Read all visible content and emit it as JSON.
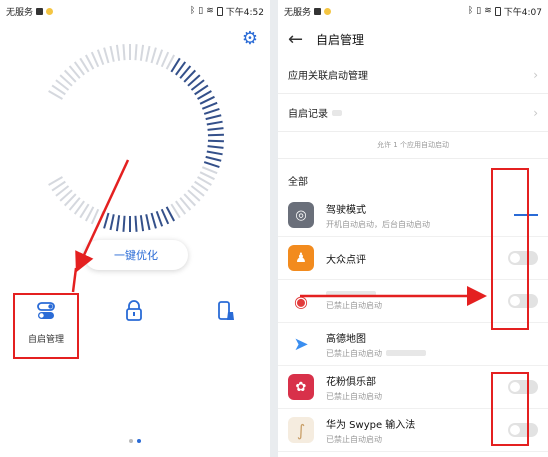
{
  "left_phone": {
    "status": {
      "carrier": "无服务",
      "time": "下午4:52"
    },
    "optimize_button": "一键优化",
    "grid": [
      {
        "label": "自启管理",
        "icon": "toggle-switches-icon"
      },
      {
        "label": "",
        "icon": "lock-icon"
      },
      {
        "label": "",
        "icon": "phone-clean-icon"
      }
    ],
    "accent": "#2a6bd6"
  },
  "right_phone": {
    "status": {
      "carrier": "无服务",
      "time": "下午4:07"
    },
    "title": "自启管理",
    "nav_rows": [
      {
        "label": "应用关联启动管理"
      },
      {
        "label": "自启记录"
      }
    ],
    "hint": "允许 1 个应用自动启动",
    "section_label": "全部",
    "apps": [
      {
        "name": "驾驶模式",
        "sub": "开机自动启动，后台自动启动",
        "icon": "steering-wheel-icon",
        "color": "#6a6f7a",
        "toggle": false
      },
      {
        "name": "大众点评",
        "sub": "",
        "icon": "dianping-icon",
        "color": "#f28b1e",
        "toggle": false
      },
      {
        "name": "",
        "sub": "已禁止自动启动",
        "icon": "netease-music-icon",
        "color": "#e23b3b",
        "toggle": false
      },
      {
        "name": "高德地图",
        "sub": "已禁止自动启动",
        "icon": "amap-icon",
        "color": "#3a8ef0",
        "toggle": null
      },
      {
        "name": "花粉俱乐部",
        "sub": "已禁止自动启动",
        "icon": "huawei-club-icon",
        "color": "#d8314a",
        "toggle": false
      },
      {
        "name": "华为 Swype 输入法",
        "sub": "已禁止自动启动",
        "icon": "swype-icon",
        "color": "#f0e6d8",
        "toggle": false
      }
    ]
  },
  "annotation_color": "#e42020"
}
